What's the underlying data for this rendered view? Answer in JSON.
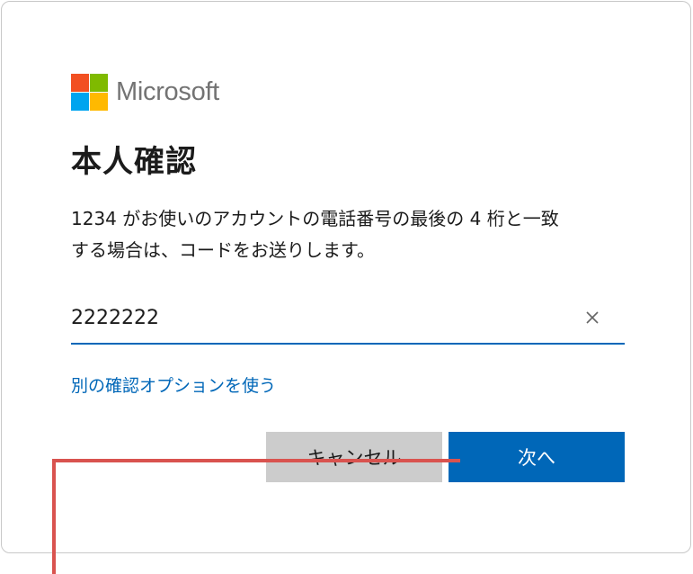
{
  "brand": {
    "name": "Microsoft",
    "logo_colors": [
      "#f25022",
      "#7fba00",
      "#00a4ef",
      "#ffb900"
    ]
  },
  "dialog": {
    "title": "本人確認",
    "description_line1": "1234 がお使いのアカウントの電話番号の最後の 4 桁と一致",
    "description_line2": "する場合は、コードをお送りします。",
    "input_value": "2222222",
    "clear_icon": "close-icon",
    "alt_option_link": "別の確認オプションを使う",
    "cancel_label": "キャンセル",
    "next_label": "次へ"
  },
  "colors": {
    "accent": "#0067b8",
    "cancel_bg": "#cccccc",
    "annotation": "#d9534f"
  }
}
